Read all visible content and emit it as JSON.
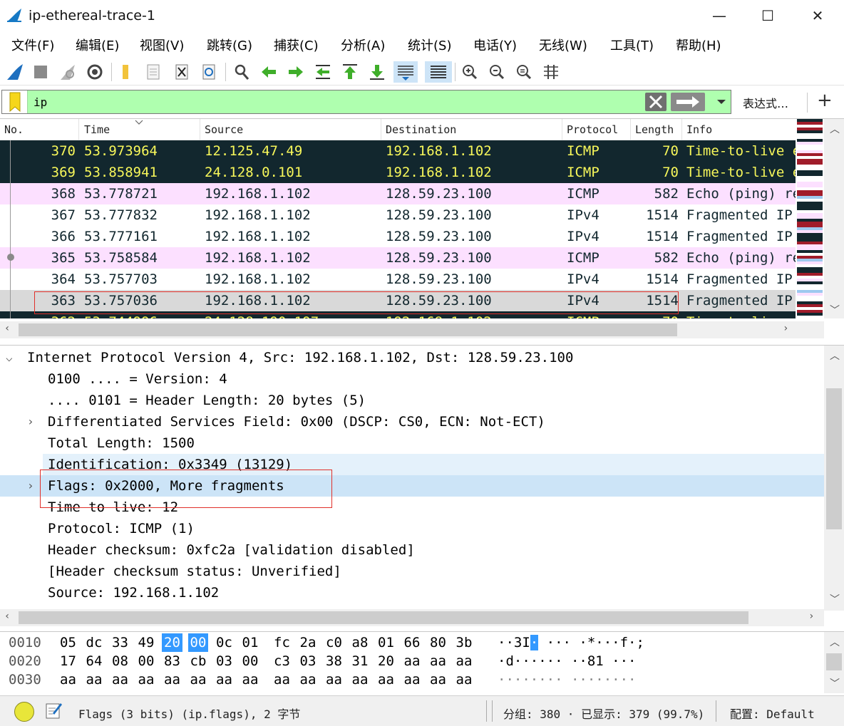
{
  "window": {
    "title": "ip-ethereal-trace-1",
    "minimize": "—",
    "maximize": "☐",
    "close": "✕"
  },
  "menu": [
    "文件(F)",
    "编辑(E)",
    "视图(V)",
    "跳转(G)",
    "捕获(C)",
    "分析(A)",
    "统计(S)",
    "电话(Y)",
    "无线(W)",
    "工具(T)",
    "帮助(H)"
  ],
  "toolbar_icons": [
    "shark-fin-start-icon",
    "stop-capture-icon",
    "restart-capture-icon",
    "capture-options-icon",
    "open-file-icon",
    "save-file-icon",
    "close-file-icon",
    "reload-file-icon",
    "find-packet-icon",
    "go-back-icon",
    "go-forward-icon",
    "go-to-packet-icon",
    "first-packet-icon",
    "last-packet-icon",
    "auto-scroll-icon",
    "colorize-icon",
    "zoom-in-icon",
    "zoom-out-icon",
    "normal-size-icon",
    "resize-columns-icon"
  ],
  "filter": {
    "value": "ip",
    "expression_label": "表达式…",
    "plus": "+",
    "color": "#afffaf"
  },
  "packet_list": {
    "columns": [
      "No.",
      "Time",
      "Source",
      "Destination",
      "Protocol",
      "Length",
      "Info"
    ],
    "rows": [
      {
        "no": "370",
        "time": "53.973964",
        "src": "12.125.47.49",
        "dst": "192.168.1.102",
        "proto": "ICMP",
        "len": "70",
        "info": "Time-to-live exceeded",
        "style": "dark"
      },
      {
        "no": "369",
        "time": "53.858941",
        "src": "24.128.0.101",
        "dst": "192.168.1.102",
        "proto": "ICMP",
        "len": "70",
        "info": "Time-to-live exceeded",
        "style": "dark"
      },
      {
        "no": "368",
        "time": "53.778721",
        "src": "192.168.1.102",
        "dst": "128.59.23.100",
        "proto": "ICMP",
        "len": "582",
        "info": "Echo (ping) request",
        "style": "pink"
      },
      {
        "no": "367",
        "time": "53.777832",
        "src": "192.168.1.102",
        "dst": "128.59.23.100",
        "proto": "IPv4",
        "len": "1514",
        "info": "Fragmented IP protocol",
        "style": "white"
      },
      {
        "no": "366",
        "time": "53.777161",
        "src": "192.168.1.102",
        "dst": "128.59.23.100",
        "proto": "IPv4",
        "len": "1514",
        "info": "Fragmented IP protocol",
        "style": "white"
      },
      {
        "no": "365",
        "time": "53.758584",
        "src": "192.168.1.102",
        "dst": "128.59.23.100",
        "proto": "ICMP",
        "len": "582",
        "info": "Echo (ping) request",
        "style": "pink"
      },
      {
        "no": "364",
        "time": "53.757703",
        "src": "192.168.1.102",
        "dst": "128.59.23.100",
        "proto": "IPv4",
        "len": "1514",
        "info": "Fragmented IP protocol",
        "style": "white"
      },
      {
        "no": "363",
        "time": "53.757036",
        "src": "192.168.1.102",
        "dst": "128.59.23.100",
        "proto": "IPv4",
        "len": "1514",
        "info": "Fragmented IP protocol",
        "style": "selected"
      },
      {
        "no": "362",
        "time": "53.744996",
        "src": "24.128.190.197",
        "dst": "192.168.1.102",
        "proto": "ICMP",
        "len": "70",
        "info": "Time-to-live exceeded",
        "style": "dark"
      }
    ]
  },
  "details": {
    "rows": [
      {
        "text": "Internet Protocol Version 4, Src: 192.168.1.102, Dst: 128.59.23.100",
        "indent": 0,
        "arrow": "⌵",
        "hl": ""
      },
      {
        "text": "0100 .... = Version: 4",
        "indent": 1,
        "arrow": "",
        "hl": ""
      },
      {
        "text": ".... 0101 = Header Length: 20 bytes (5)",
        "indent": 1,
        "arrow": "",
        "hl": ""
      },
      {
        "text": "Differentiated Services Field: 0x00 (DSCP: CS0, ECN: Not-ECT)",
        "indent": 1,
        "arrow": "›",
        "hl": ""
      },
      {
        "text": "Total Length: 1500",
        "indent": 1,
        "arrow": "",
        "hl": ""
      },
      {
        "text": "Identification: 0x3349 (13129)",
        "indent": 1,
        "arrow": "",
        "hl": "light"
      },
      {
        "text": "Flags: 0x2000, More fragments",
        "indent": 1,
        "arrow": "›",
        "hl": "sel"
      },
      {
        "text": "Time to live: 12",
        "indent": 1,
        "arrow": "",
        "hl": ""
      },
      {
        "text": "Protocol: ICMP (1)",
        "indent": 1,
        "arrow": "",
        "hl": ""
      },
      {
        "text": "Header checksum: 0xfc2a [validation disabled]",
        "indent": 1,
        "arrow": "",
        "hl": ""
      },
      {
        "text": "[Header checksum status: Unverified]",
        "indent": 1,
        "arrow": "",
        "hl": ""
      },
      {
        "text": "Source: 192.168.1.102",
        "indent": 1,
        "arrow": "",
        "hl": ""
      }
    ]
  },
  "bytes": {
    "rows": [
      {
        "offset": "0010",
        "hex1": [
          "05",
          "dc",
          "33",
          "49",
          "20",
          "00",
          "0c",
          "01"
        ],
        "hex2": [
          "fc",
          "2a",
          "c0",
          "a8",
          "01",
          "66",
          "80",
          "3b"
        ],
        "ascii": "··3I ··· ·*···f·;"
      },
      {
        "offset": "0020",
        "hex1": [
          "17",
          "64",
          "08",
          "00",
          "83",
          "cb",
          "03",
          "00"
        ],
        "hex2": [
          "c3",
          "03",
          "38",
          "31",
          "20",
          "aa",
          "aa",
          "aa"
        ],
        "ascii": "·d······ ··81 ···"
      },
      {
        "offset": "0030",
        "hex1": [
          "aa",
          "aa",
          "aa",
          "aa",
          "aa",
          "aa",
          "aa",
          "aa"
        ],
        "hex2": [
          "aa",
          "aa",
          "aa",
          "aa",
          "aa",
          "aa",
          "aa",
          "aa"
        ],
        "ascii": "········ ········"
      }
    ],
    "highlight_hex": [
      "20",
      "00"
    ]
  },
  "status": {
    "field_info": "Flags (3 bits) (ip.flags), 2 字节",
    "stats": "分组: 380 · 已显示: 379 (99.7%)",
    "profile": "配置: Default"
  }
}
